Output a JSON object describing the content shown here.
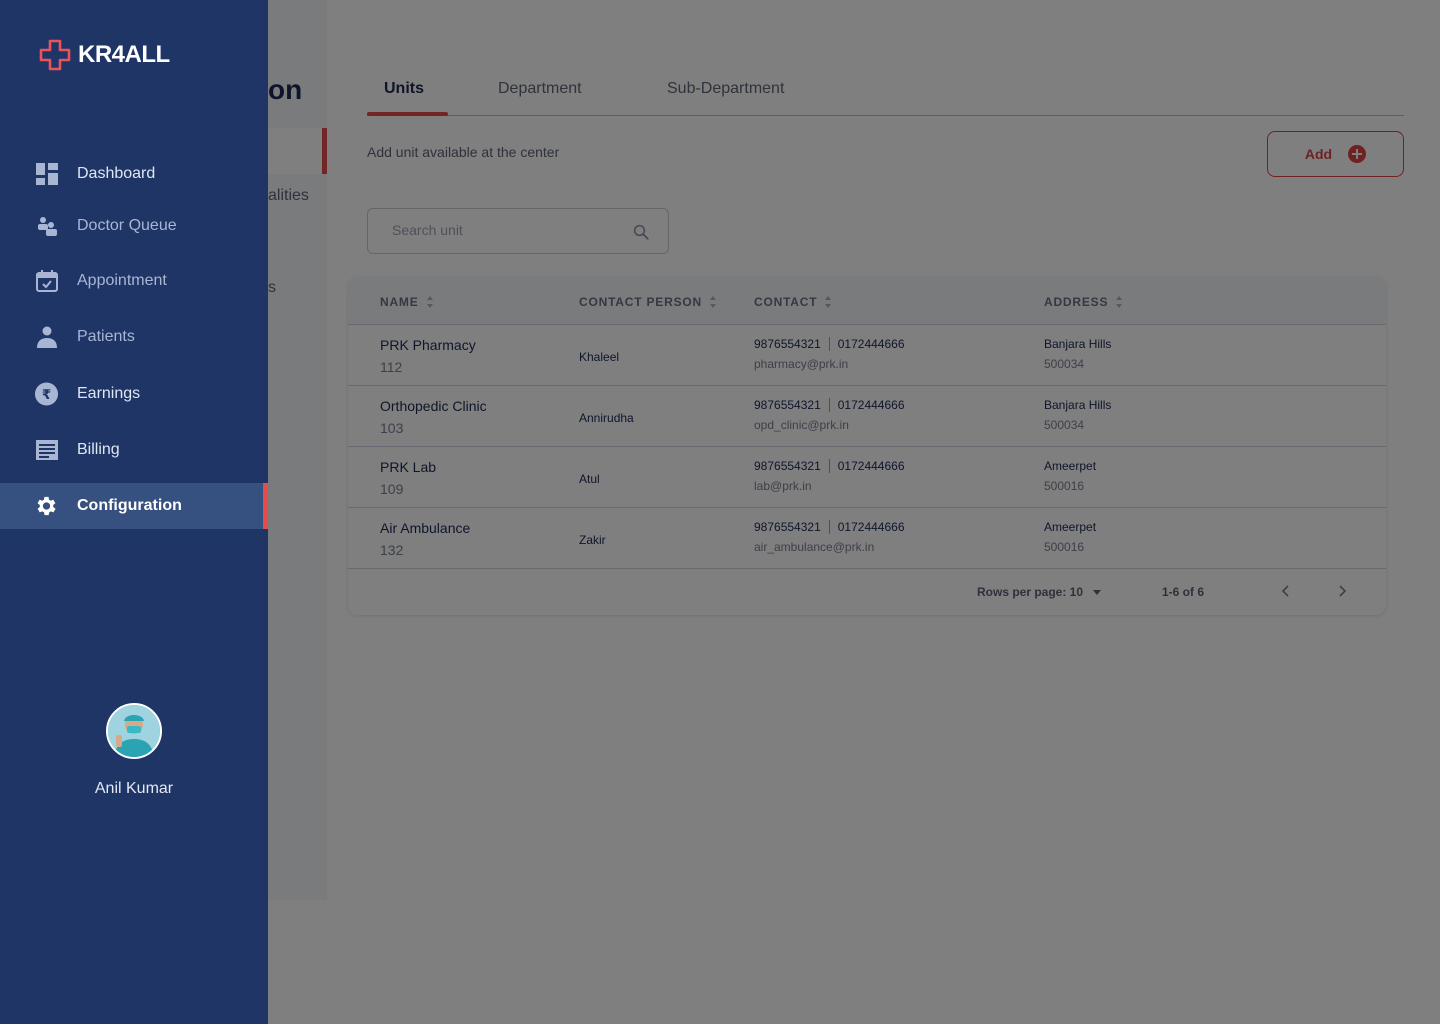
{
  "app": {
    "brand": "KR4ALL"
  },
  "sidebar": {
    "items": [
      {
        "label": "Dashboard",
        "icon": "dashboard-icon"
      },
      {
        "label": "Doctor Queue",
        "icon": "doctor-queue-icon"
      },
      {
        "label": "Appointment",
        "icon": "calendar-icon"
      },
      {
        "label": "Patients",
        "icon": "patient-icon"
      },
      {
        "label": "Earnings",
        "icon": "rupee-icon"
      },
      {
        "label": "Billing",
        "icon": "billing-icon"
      },
      {
        "label": "Configuration",
        "icon": "gear-icon",
        "active": true
      }
    ],
    "user": {
      "name": "Anil Kumar"
    }
  },
  "config_menu": {
    "title_fragment": "on",
    "items": [
      "alities",
      "s"
    ]
  },
  "tabs": [
    {
      "label": "Units",
      "active": true
    },
    {
      "label": "Department"
    },
    {
      "label": "Sub-Department"
    }
  ],
  "units": {
    "subtitle": "Add unit available at the center",
    "add_label": "Add",
    "search_placeholder": "Search unit",
    "columns": [
      "NAME",
      "CONTACT PERSON",
      "CONTACT",
      "ADDRESS"
    ],
    "rows": [
      {
        "name": "PRK Pharmacy",
        "code": "112",
        "person": "Khaleel",
        "phone1": "9876554321",
        "phone2": "0172444666",
        "email": "pharmacy@prk.in",
        "address": "Banjara Hills",
        "pin": "500034"
      },
      {
        "name": "Orthopedic Clinic",
        "code": "103",
        "person": "Annirudha",
        "phone1": "9876554321",
        "phone2": "0172444666",
        "email": "opd_clinic@prk.in",
        "address": "Banjara Hills",
        "pin": "500034"
      },
      {
        "name": "PRK Lab",
        "code": "109",
        "person": "Atul",
        "phone1": "9876554321",
        "phone2": "0172444666",
        "email": "lab@prk.in",
        "address": "Ameerpet",
        "pin": "500016"
      },
      {
        "name": "Air Ambulance",
        "code": "132",
        "person": "Zakir",
        "phone1": "9876554321",
        "phone2": "0172444666",
        "email": "air_ambulance@prk.in",
        "address": "Ameerpet",
        "pin": "500016"
      }
    ],
    "pagination": {
      "rows_per_page": "Rows per page: 10",
      "range": "1-6 of 6"
    }
  },
  "colors": {
    "drawer": "#1f3566",
    "accent": "#e74c4c",
    "active_item": "#36507f"
  }
}
